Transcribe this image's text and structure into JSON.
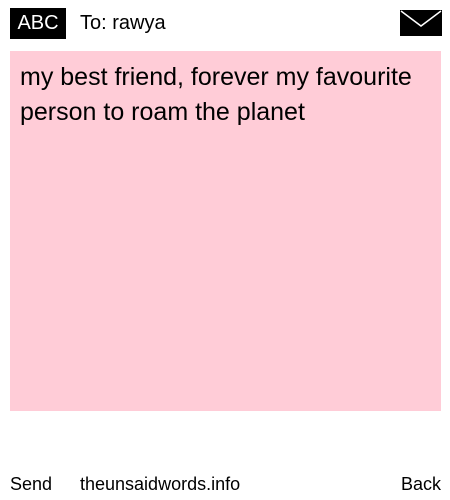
{
  "header": {
    "mode_label": "ABC",
    "recipient": "To: rawya",
    "envelope_icon": "envelope-icon"
  },
  "message": {
    "text": "my best friend, forever my favourite person to roam the planet",
    "background_color": "#ffccd7"
  },
  "footer": {
    "send_label": "Send",
    "site_label": "theunsaidwords.info",
    "back_label": "Back"
  }
}
